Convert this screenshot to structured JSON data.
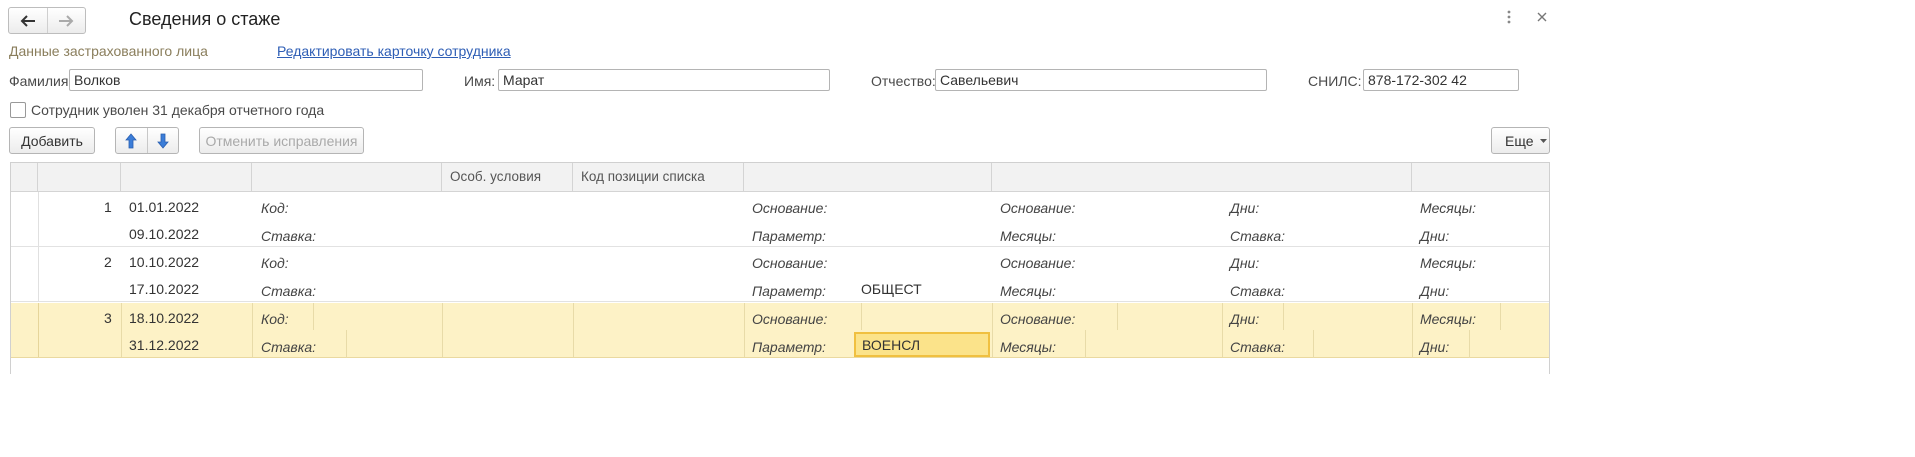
{
  "window": {
    "title": "Сведения о стаже"
  },
  "header": {
    "insured_label": "Данные застрахованного лица",
    "edit_link": "Редактировать карточку сотрудника"
  },
  "fields": {
    "surname_label": "Фамилия:",
    "surname_value": "Волков",
    "name_label": "Имя:",
    "name_value": "Марат",
    "patronymic_label": "Отчество:",
    "patronymic_value": "Савельевич",
    "snils_label": "СНИЛС:",
    "snils_value": "878-172-302 42"
  },
  "dismissed": {
    "label": "Сотрудник уволен 31 декабря отчетного года",
    "checked": false
  },
  "toolbar": {
    "add": "Добавить",
    "cancel_corrections": "Отменить исправления",
    "more": "Еще"
  },
  "table": {
    "headers": {
      "special_conditions": "Особ. условия",
      "list_position_code": "Код позиции списка"
    },
    "labels": {
      "code": "Код:",
      "rate": "Ставка:",
      "basis": "Основание:",
      "parameter": "Параметр:",
      "months": "Месяцы:",
      "days": "Дни:"
    },
    "rows": [
      {
        "num": "1",
        "date_from": "01.01.2022",
        "date_to": "09.10.2022",
        "parameter_value": ""
      },
      {
        "num": "2",
        "date_from": "10.10.2022",
        "date_to": "17.10.2022",
        "parameter_value": "ОБЩЕСТ"
      },
      {
        "num": "3",
        "date_from": "18.10.2022",
        "date_to": "31.12.2022",
        "parameter_value": "ВОЕНСЛ"
      }
    ]
  },
  "icons": [
    "back-arrow-icon",
    "forward-arrow-icon",
    "more-vertical-icon",
    "close-icon",
    "move-up-icon",
    "move-down-icon",
    "dropdown-caret-icon"
  ]
}
